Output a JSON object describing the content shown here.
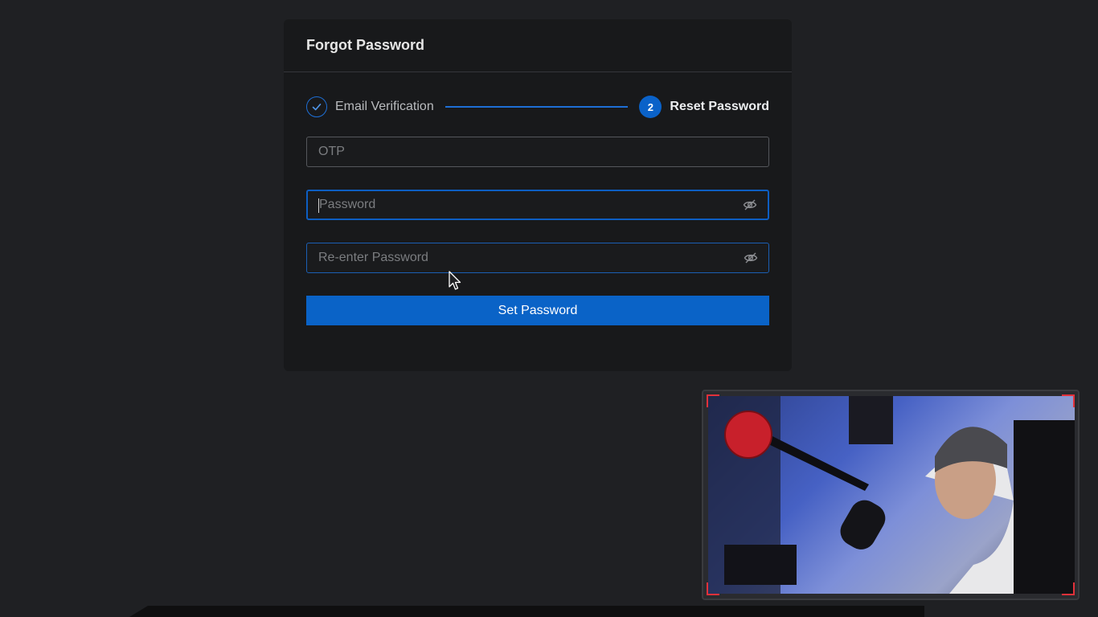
{
  "card": {
    "title": "Forgot Password",
    "stepper": {
      "step1_label": "Email Verification",
      "step2_number": "2",
      "step2_label": "Reset Password"
    },
    "fields": {
      "otp_placeholder": "OTP",
      "password_placeholder": "Password",
      "reenter_placeholder": "Re-enter Password"
    },
    "submit_label": "Set Password"
  },
  "colors": {
    "accent": "#0a63c7",
    "background": "#1f2023",
    "card": "#18191b"
  },
  "icons": {
    "step_done": "check-icon",
    "password_toggle": "eye-off-icon",
    "cursor": "mouse-pointer-icon"
  }
}
